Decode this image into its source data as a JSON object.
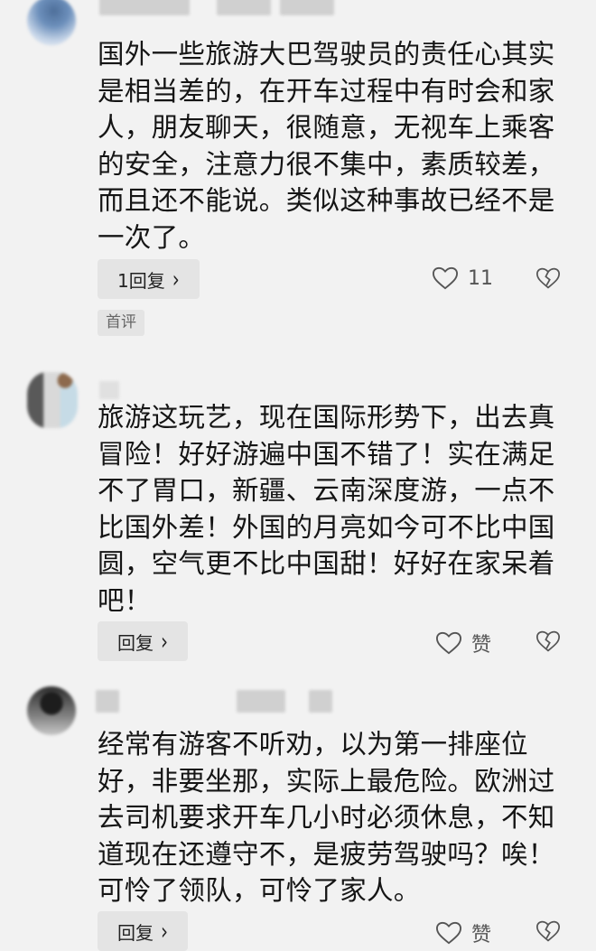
{
  "comments": [
    {
      "text": "国外一些旅游大巴驾驶员的责任心其实是相当差的，在开车过程中有时会和家人，朋友聊天，很随意，无视车上乘客的安全，注意力很不集中，素质较差，而且还不能说。类似这种事故已经不是一次了。",
      "reply_label": "1回复",
      "like_label": "11",
      "tag": "首评"
    },
    {
      "text": "旅游这玩艺，现在国际形势下，出去真冒险！好好游遍中国不错了！实在满足不了胃口，新疆、云南深度游，一点不比国外差！外国的月亮如今可不比中国圆，空气更不比中国甜！好好在家呆着吧！",
      "reply_label": "回复",
      "like_label": "赞"
    },
    {
      "text": "经常有游客不听劝，以为第一排座位好，非要坐那，实际上最危险。欧洲过去司机要求开车几小时必须休息，不知道现在还遵守不，是疲劳驾驶吗？唉！可怜了领队，可怜了家人。",
      "reply_label": "回复",
      "like_label": "赞"
    }
  ],
  "icons": {
    "like": "heart-outline-icon",
    "dislike": "broken-heart-icon",
    "chevron": "chevron-right-icon"
  },
  "colors": {
    "background": "#f2f2f2",
    "button_background": "#e4e4e4",
    "text": "#151515",
    "icon": "#555555"
  }
}
